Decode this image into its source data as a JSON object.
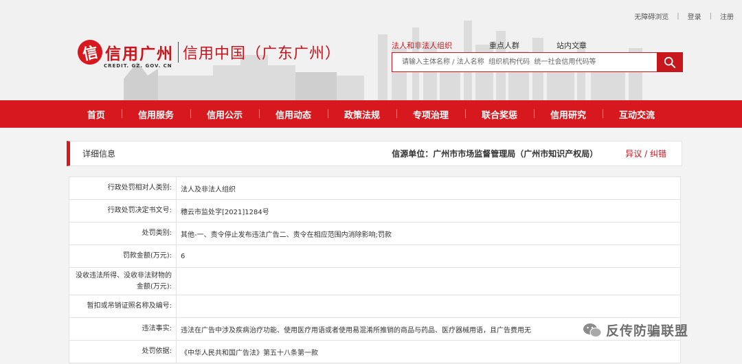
{
  "top_links": [
    "无障碍浏览",
    "登录",
    "注册"
  ],
  "logo": {
    "mark": "信",
    "text": "信用广州",
    "subtitle": "CREDIT. GZ. GOV. CN",
    "title": "信用中国（广东广州）"
  },
  "search": {
    "tabs": [
      "法人和非法人组织",
      "重点人群",
      "站内文章"
    ],
    "placeholder": "请输入主体名称 / 法人名称  组织机构代码  统一社会信用代码等"
  },
  "nav": [
    "首页",
    "信用服务",
    "信用公示",
    "信用动态",
    "政策法规",
    "专项治理",
    "联合奖惩",
    "信用研究",
    "互动交流"
  ],
  "panel": {
    "title": "详细信息",
    "source": "信源单位：广州市市场监督管理局（广州市知识产权局）",
    "objection": "异议 / 纠错"
  },
  "rows": [
    {
      "label": "行政处罚相对人类别:",
      "value": "法人及非法人组织"
    },
    {
      "label": "行政处罚决定书文号:",
      "value": "穗云市监处字[2021]1284号"
    },
    {
      "label": "处罚类别:",
      "value": "其他-一、责令停止发布违法广告二、责令在相应范围内消除影响;罚款"
    },
    {
      "label": "罚款金额(万元):",
      "value": "6"
    },
    {
      "label": "没收违法所得、没收非法财物的金额(万元):",
      "value": ""
    },
    {
      "label": "暂扣或吊销证照名称及编号:",
      "value": ""
    },
    {
      "label": "违法事实:",
      "value": "违法在广告中涉及疾病治疗功能、使用医疗用语或者使用易混淆所推销的商品与药品、医疗器械用语，且广告费用无"
    },
    {
      "label": "处罚依据:",
      "value": "《中华人民共和国广告法》第五十八条第一款"
    }
  ],
  "watermark": "反传防骗联盟",
  "colors": {
    "brand_red": "#d7191f"
  }
}
